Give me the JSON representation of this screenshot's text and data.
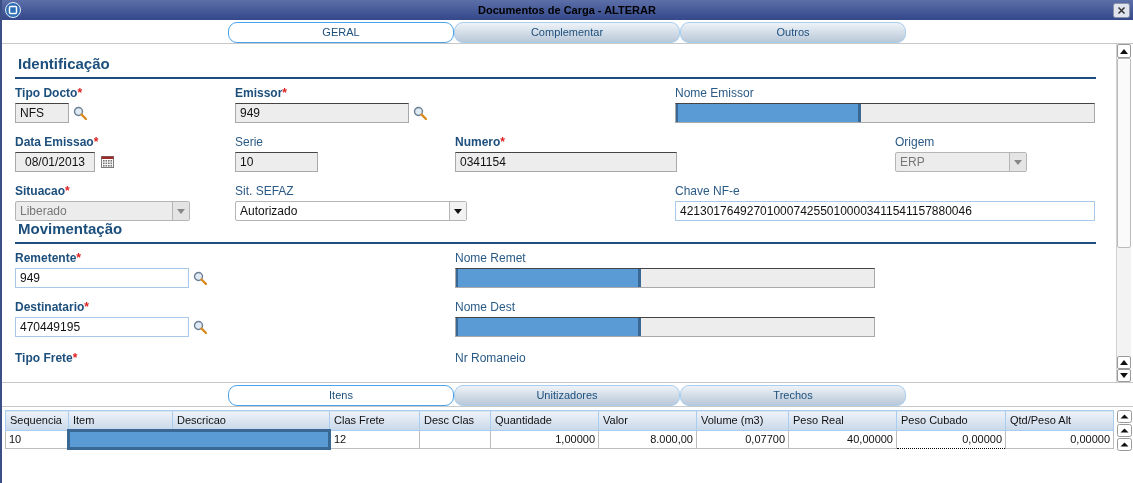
{
  "window": {
    "title": "Documentos de Carga - ALTERAR"
  },
  "tabs": [
    {
      "label": "GERAL",
      "selected": true
    },
    {
      "label": "Complementar",
      "selected": false
    },
    {
      "label": "Outros",
      "selected": false
    }
  ],
  "sections": [
    {
      "title": "Identificação",
      "rows": [
        [
          {
            "label": "Tipo Docto",
            "mark": "*",
            "kind": "text",
            "value": "NFS",
            "disabled": true,
            "lookup": true
          },
          {
            "label": "Emissor",
            "mark": "*",
            "kind": "text",
            "value": "949",
            "disabled": true,
            "lookup": true
          },
          {
            "label": "Nome Emissor",
            "kind": "text",
            "disabled": true,
            "redacted": true
          }
        ],
        [
          {
            "label": "Data Emissao",
            "mark": "*",
            "kind": "date",
            "value": "08/01/2013",
            "disabled": true
          },
          {
            "label": "Serie",
            "kind": "text",
            "value": "10",
            "disabled": true
          },
          {
            "label": "Numero",
            "mark": "*",
            "kind": "text",
            "value": "0341154",
            "disabled": true
          },
          {
            "label": "Origem",
            "kind": "select",
            "value": "ERP",
            "disabled": true
          }
        ],
        [
          {
            "label": "Situacao",
            "mark": "*",
            "kind": "select",
            "value": "Liberado",
            "disabled": true
          },
          {
            "label": "Sit. SEFAZ",
            "kind": "select",
            "value": "Autorizado",
            "disabled": false
          },
          {
            "label": "Chave NF-e",
            "kind": "text",
            "value": "42130176492701000742550100003411541157880046",
            "disabled": false
          }
        ]
      ]
    },
    {
      "title": "Movimentação",
      "rows": [
        [
          {
            "label": "Remetente",
            "mark": "*",
            "kind": "text",
            "value": "949",
            "disabled": false,
            "lookup": true
          },
          {
            "label": "Nome Remet",
            "kind": "text",
            "disabled": true,
            "redacted": true
          }
        ],
        [
          {
            "label": "Destinatario",
            "mark": "*",
            "kind": "text",
            "value": "470449195",
            "disabled": false,
            "lookup": true
          },
          {
            "label": "Nome Dest",
            "kind": "text",
            "disabled": true,
            "redacted": true
          }
        ],
        [
          {
            "label": "Tipo Frete",
            "mark": "*",
            "kind": "cut"
          },
          {
            "label": "Nr Romaneio",
            "kind": "cut"
          }
        ]
      ]
    }
  ],
  "item_tabs": [
    {
      "label": "Itens",
      "selected": true
    },
    {
      "label": "Unitizadores",
      "selected": false
    },
    {
      "label": "Trechos",
      "selected": false
    }
  ],
  "table": {
    "columns": [
      "Sequencia",
      "Item",
      "Descricao",
      "Clas Frete",
      "Desc Clas",
      "Quantidade",
      "Valor",
      "Volume (m3)",
      "Peso Real",
      "Peso Cubado",
      "Qtd/Peso Alt"
    ],
    "rows": [
      {
        "cells": [
          {
            "kind": "text",
            "text": "10",
            "focused": false
          },
          {
            "kind": "redacted",
            "focused": false
          },
          {
            "kind": "redacted",
            "focused": false
          },
          {
            "kind": "text",
            "text": "12",
            "focused": false
          },
          {
            "kind": "empty",
            "focused": false
          },
          {
            "kind": "text",
            "text": "1,00000",
            "focused": false
          },
          {
            "kind": "text",
            "text": "8.000,00",
            "focused": false
          },
          {
            "kind": "text",
            "text": "0,07700",
            "focused": false
          },
          {
            "kind": "text",
            "text": "40,00000",
            "focused": false
          },
          {
            "kind": "text",
            "text": "0,00000",
            "focused": true
          },
          {
            "kind": "text",
            "text": "0,00000",
            "focused": false
          }
        ]
      }
    ]
  }
}
